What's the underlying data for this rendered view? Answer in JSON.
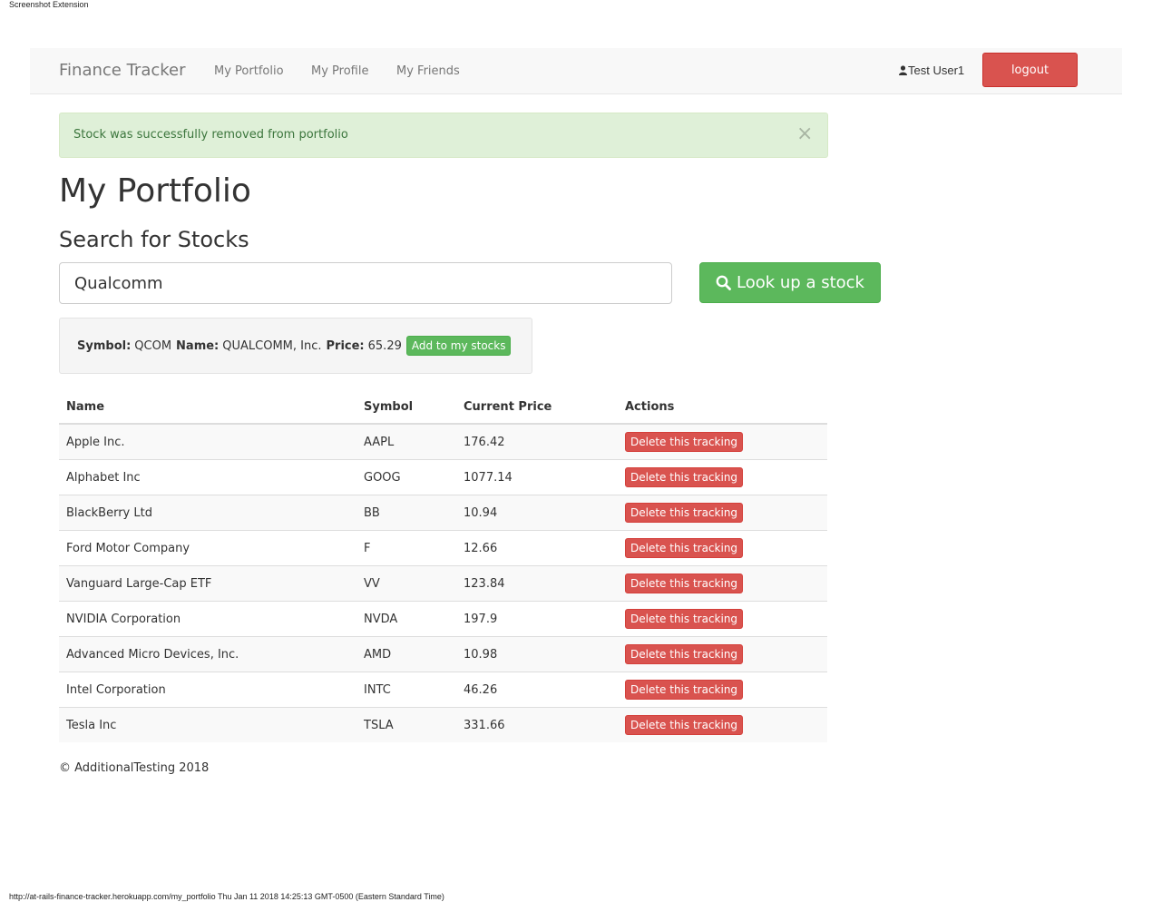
{
  "extension_label": "Screenshot Extension",
  "navbar": {
    "brand": "Finance Tracker",
    "links": [
      "My Portfolio",
      "My Profile",
      "My Friends"
    ],
    "user": "Test User1",
    "logout": "logout"
  },
  "alert": {
    "message": "Stock was successfully removed from portfolio",
    "close": "×"
  },
  "page_title": "My Portfolio",
  "search": {
    "heading": "Search for Stocks",
    "value": "Qualcomm",
    "button": "Look up a stock"
  },
  "result": {
    "symbol_label": "Symbol:",
    "symbol": "QCOM",
    "name_label": "Name:",
    "name": "QUALCOMM, Inc.",
    "price_label": "Price:",
    "price": "65.29",
    "add_button": "Add to my stocks"
  },
  "table": {
    "headers": [
      "Name",
      "Symbol",
      "Current Price",
      "Actions"
    ],
    "delete_label": "Delete this tracking",
    "rows": [
      {
        "name": "Apple Inc.",
        "symbol": "AAPL",
        "price": "176.42"
      },
      {
        "name": "Alphabet Inc",
        "symbol": "GOOG",
        "price": "1077.14"
      },
      {
        "name": "BlackBerry Ltd",
        "symbol": "BB",
        "price": "10.94"
      },
      {
        "name": "Ford Motor Company",
        "symbol": "F",
        "price": "12.66"
      },
      {
        "name": "Vanguard Large-Cap ETF",
        "symbol": "VV",
        "price": "123.84"
      },
      {
        "name": "NVIDIA Corporation",
        "symbol": "NVDA",
        "price": "197.9"
      },
      {
        "name": "Advanced Micro Devices, Inc.",
        "symbol": "AMD",
        "price": "10.98"
      },
      {
        "name": "Intel Corporation",
        "symbol": "INTC",
        "price": "46.26"
      },
      {
        "name": "Tesla Inc",
        "symbol": "TSLA",
        "price": "331.66"
      }
    ]
  },
  "footer": "© AdditionalTesting 2018",
  "status_bar": "http://at-rails-finance-tracker.herokuapp.com/my_portfolio Thu Jan 11 2018 14:25:13 GMT-0500 (Eastern Standard Time)",
  "colors": {
    "danger": "#d9534f",
    "success": "#5cb85c",
    "alert_bg": "#dff0d8"
  }
}
